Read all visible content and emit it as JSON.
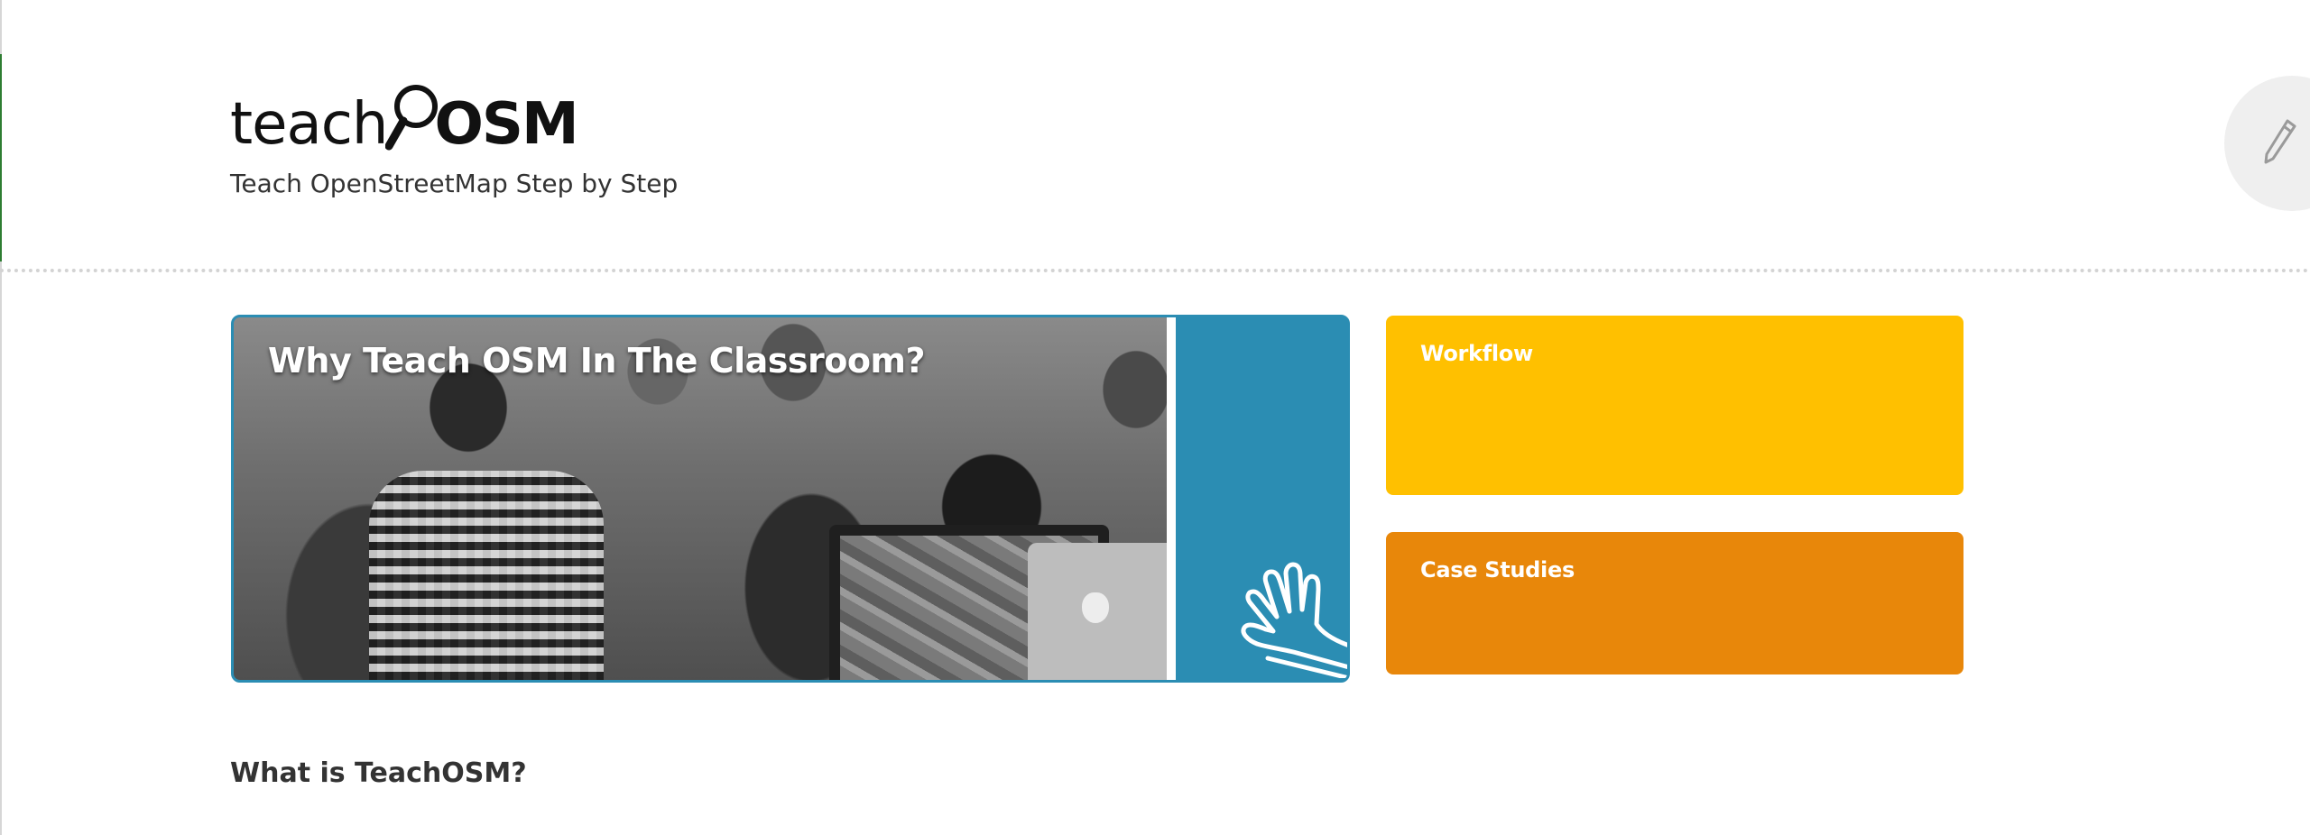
{
  "header": {
    "logo_text_regular": "teach",
    "logo_text_bold": "OSM",
    "tagline": "Teach OpenStreetMap Step by Step",
    "edit_icon": "pencil-icon"
  },
  "feature": {
    "title": "Why Teach OSM In The Classroom?",
    "icon": "raised-hand-icon",
    "accent_color": "#2b8db3"
  },
  "cards": [
    {
      "label": "Workflow",
      "color": "#ffc000"
    },
    {
      "label": "Case Studies",
      "color": "#e8870a"
    }
  ],
  "content": {
    "heading": "What is TeachOSM?"
  }
}
